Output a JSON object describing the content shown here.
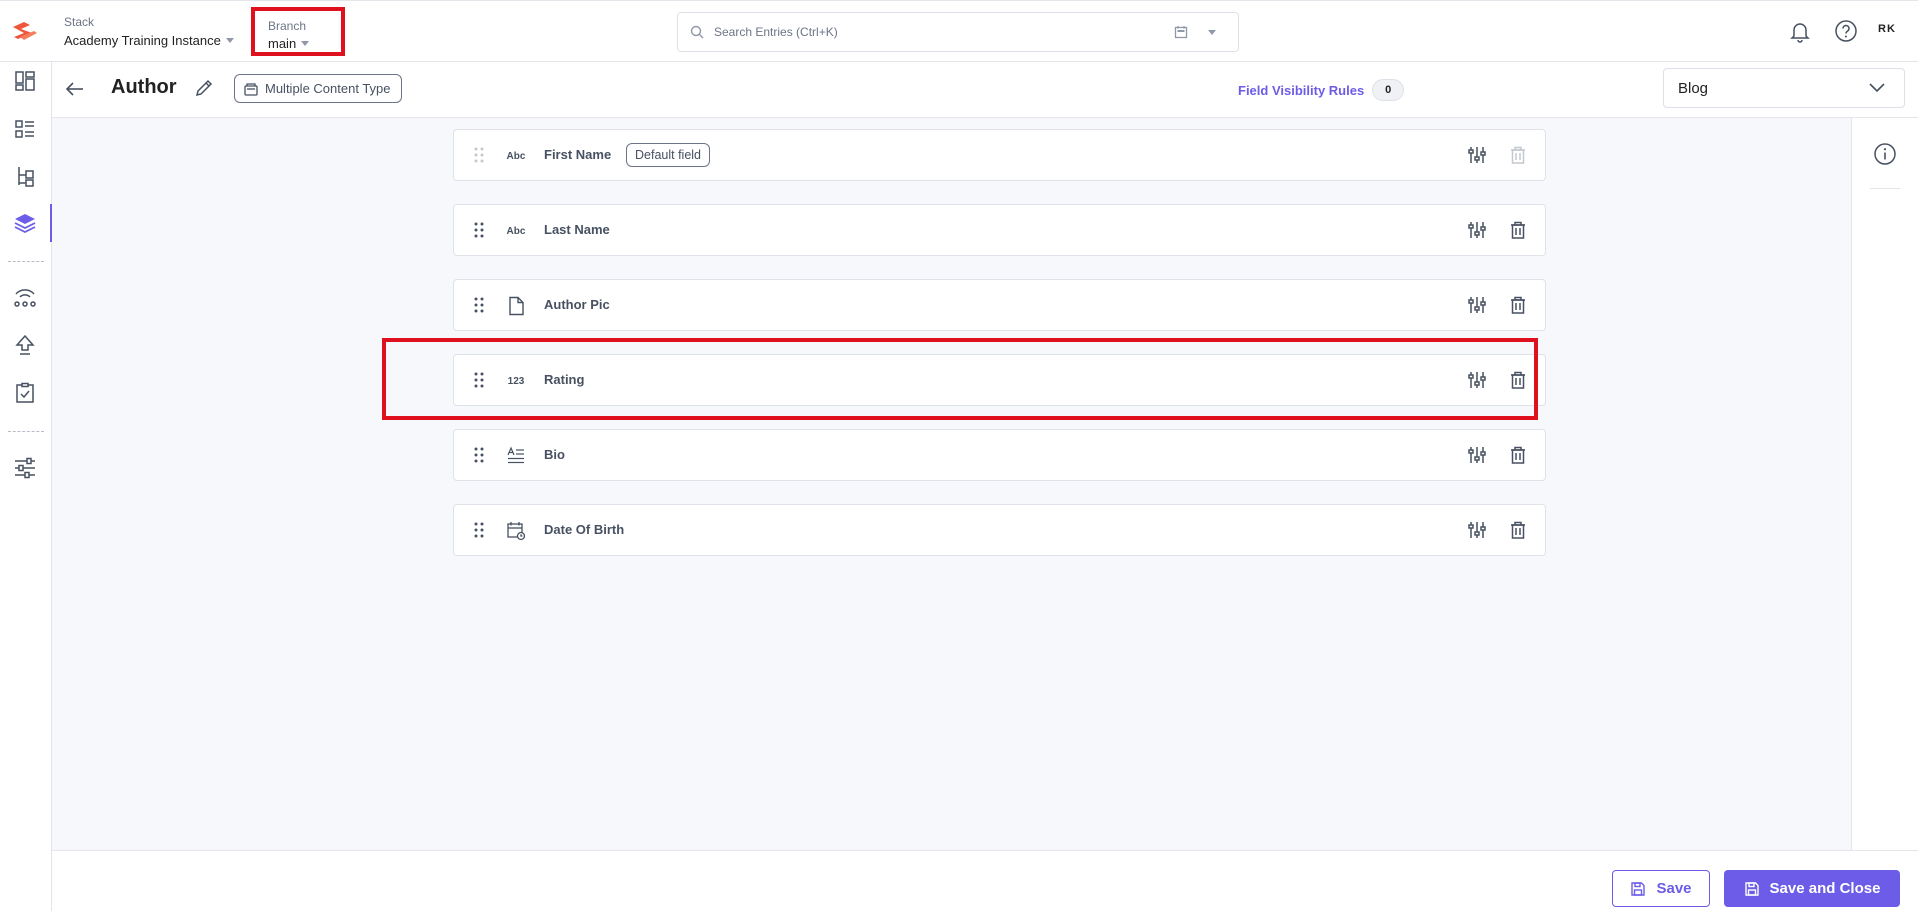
{
  "topbar": {
    "stack_label": "Stack",
    "stack_value": "Academy Training Instance",
    "branch_label": "Branch",
    "branch_value": "main",
    "search_placeholder": "Search Entries (Ctrl+K)",
    "avatar_initials": "RK"
  },
  "sidebar": {
    "items": [
      {
        "icon": "dashboard-icon"
      },
      {
        "icon": "entries-list-icon"
      },
      {
        "icon": "content-tree-icon"
      },
      {
        "icon": "content-models-layers-icon",
        "active": true
      },
      {
        "icon": "network-icon"
      },
      {
        "icon": "publish-upload-icon"
      },
      {
        "icon": "tasks-clipboard-icon"
      },
      {
        "icon": "settings-sliders-icon"
      }
    ]
  },
  "header": {
    "title": "Author",
    "content_type_badge": "Multiple Content Type",
    "field_visibility_label": "Field Visibility Rules",
    "field_visibility_count": "0",
    "selected_content_type": "Blog"
  },
  "fields": [
    {
      "name": "First Name",
      "type_icon": "Abc",
      "badge": "Default field",
      "deletable": false
    },
    {
      "name": "Last Name",
      "type_icon": "Abc",
      "badge": "",
      "deletable": true
    },
    {
      "name": "Author Pic",
      "type_icon": "file-icon",
      "badge": "",
      "deletable": true
    },
    {
      "name": "Rating",
      "type_icon": "123",
      "badge": "",
      "deletable": true,
      "highlighted": true
    },
    {
      "name": "Bio",
      "type_icon": "rich-text-icon",
      "badge": "",
      "deletable": true
    },
    {
      "name": "Date Of Birth",
      "type_icon": "calendar-icon",
      "badge": "",
      "deletable": true
    }
  ],
  "footer": {
    "save_label": "Save",
    "save_close_label": "Save and Close"
  },
  "colors": {
    "accent": "#6c5ce7",
    "highlight": "#e0111f",
    "logo": "#f0563c"
  }
}
